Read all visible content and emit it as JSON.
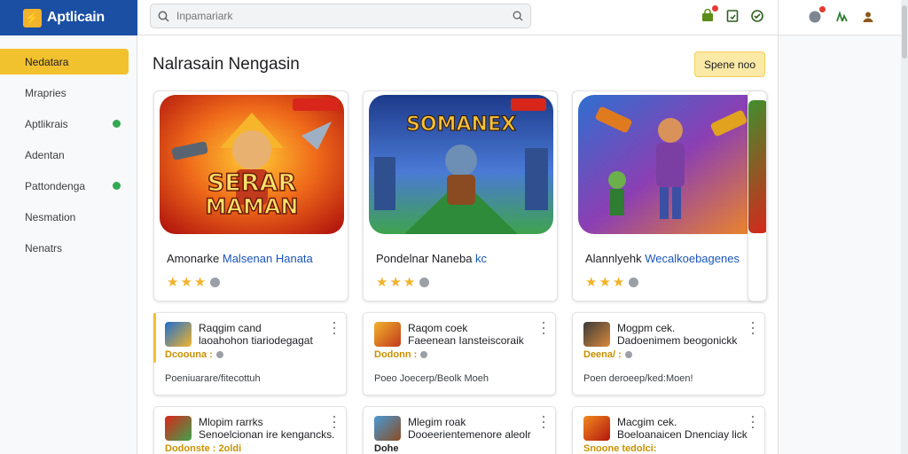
{
  "app": {
    "name": "Aptlicain",
    "logo_icon": "app-logo-icon"
  },
  "search": {
    "placeholder": "Inpamariark"
  },
  "top_icons": [
    {
      "name": "shop-notifications-icon",
      "badge": true
    },
    {
      "name": "bookmark-icon",
      "badge": false
    },
    {
      "name": "check-circle-icon",
      "badge": false
    }
  ],
  "right_icons": [
    {
      "name": "globe-icon",
      "badge": true
    },
    {
      "name": "account-switch-icon",
      "badge": false
    },
    {
      "name": "profile-icon",
      "badge": false
    }
  ],
  "sidebar": {
    "items": [
      {
        "label": "Nedatara",
        "active": true,
        "dot": false
      },
      {
        "label": "Mrapries",
        "active": false,
        "dot": false
      },
      {
        "label": "Aptlikrais",
        "active": false,
        "dot": true
      },
      {
        "label": "Adentan",
        "active": false,
        "dot": false
      },
      {
        "label": "Pattondenga",
        "active": false,
        "dot": true
      },
      {
        "label": "Nesmation",
        "active": false,
        "dot": false
      },
      {
        "label": "Nenatrs",
        "active": false,
        "dot": false
      }
    ]
  },
  "main": {
    "heading": "Nalrasain Nengasin",
    "primary_button": "Spene noo",
    "featured": [
      {
        "title": "Amonarke",
        "title_accent": "Malsenan Hanata",
        "art_text_1": "SERAR",
        "art_text_2": "MAMAN",
        "stars": 3
      },
      {
        "title": "Pondelnar Naneba",
        "title_accent": "kc",
        "art_text_1": "SOMANEX",
        "art_text_2": "",
        "stars": 3
      },
      {
        "title": "Alannlyehk",
        "title_accent": "Wecalkoebagenes",
        "art_text_1": "",
        "art_text_2": "",
        "stars": 3
      }
    ],
    "list_cards": [
      {
        "title": "Raqgim cand",
        "subtitle": "laoahohon tiariodegagat",
        "meta": "Dcoouna :",
        "desc": "Poeniuarare/fitecottuh"
      },
      {
        "title": "Raqom coek",
        "subtitle": "Faeenean Iansteiscoraik",
        "meta": "Dodonn :",
        "desc": "Poeo Joecerp/Beolk Moeh"
      },
      {
        "title": "Mogpm cek.",
        "subtitle": "Dadoenimem beogonickk",
        "meta": "Deena/ :",
        "desc": "Poen deroeep/ked:Moen!"
      },
      {
        "title": "Mlopim rarrks",
        "subtitle": "Senoelcionan ire kengancks.",
        "meta": "Dodonste : 2oldi",
        "desc": ""
      },
      {
        "title": "Mlegim roak",
        "subtitle": "Dooeerientemenore aleolr",
        "meta": "Dohe",
        "desc": ""
      },
      {
        "title": "Macgim cek.",
        "subtitle": "Boeloanaicen Dnenciay lick",
        "meta": "Snoone tedolci:",
        "desc": ""
      }
    ]
  },
  "colors": {
    "brand": "#1a4fa3",
    "accent": "#f2c12e",
    "link": "#1a56b8",
    "star": "#f2b32c",
    "status_dot": "#34a853"
  }
}
